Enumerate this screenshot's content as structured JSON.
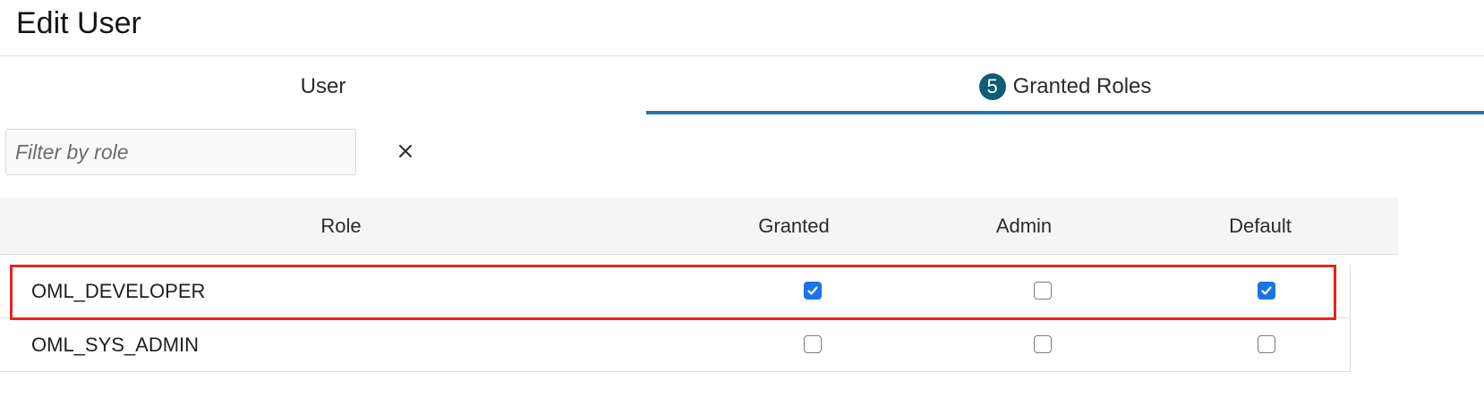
{
  "header": {
    "title": "Edit User"
  },
  "tabs": [
    {
      "label": "User",
      "active": false
    },
    {
      "label": "Granted Roles",
      "badge": "5",
      "active": true
    }
  ],
  "filter": {
    "placeholder": "Filter by role",
    "value": "",
    "clear_icon": "close-icon"
  },
  "table": {
    "columns": [
      "Role",
      "Granted",
      "Admin",
      "Default"
    ],
    "rows": [
      {
        "role": "OML_DEVELOPER",
        "granted": true,
        "admin": false,
        "default": true,
        "highlighted": true
      },
      {
        "role": "OML_SYS_ADMIN",
        "granted": false,
        "admin": false,
        "default": false,
        "highlighted": false
      }
    ]
  },
  "colors": {
    "tab_underline": "#1f77b4",
    "badge": "#0f5d74",
    "checkbox_checked": "#1a73e8",
    "highlight": "#e8231e"
  }
}
